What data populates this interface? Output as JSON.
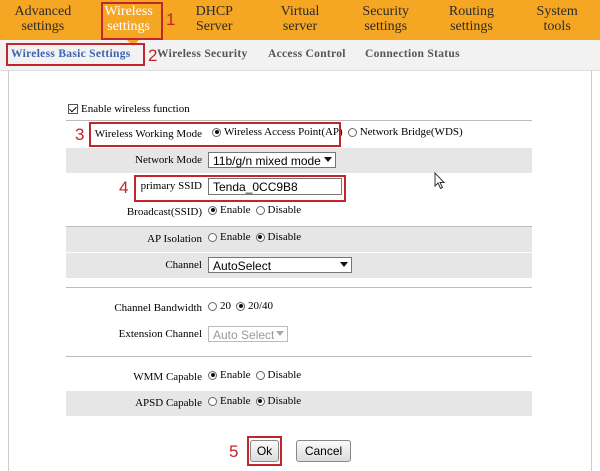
{
  "nav": {
    "items": [
      {
        "line1": "Advanced",
        "line2": "settings"
      },
      {
        "line1": "Wireless",
        "line2": "settings"
      },
      {
        "line1": "DHCP",
        "line2": "Server"
      },
      {
        "line1": "Virtual",
        "line2": "server"
      },
      {
        "line1": "Security",
        "line2": "settings"
      },
      {
        "line1": "Routing",
        "line2": "settings"
      },
      {
        "line1": "System",
        "line2": "tools"
      }
    ]
  },
  "subnav": {
    "items": [
      "Wireless Basic Settings",
      "Wireless Security",
      "Access Control",
      "Connection Status"
    ]
  },
  "annotations": [
    "1",
    "2",
    "3",
    "4",
    "5"
  ],
  "form": {
    "enable_wireless": {
      "label": "Enable wireless function",
      "checked": true
    },
    "working_mode": {
      "label": "Wireless Working Mode",
      "option_ap": "Wireless Access Point(AP)",
      "option_wds": "Network Bridge(WDS)",
      "selected": "ap"
    },
    "network_mode": {
      "label": "Network Mode",
      "value": "11b/g/n mixed mode"
    },
    "ssid": {
      "label": "primary SSID",
      "value": "Tenda_0CC9B8"
    },
    "broadcast": {
      "label": "Broadcast(SSID)",
      "enable": "Enable",
      "disable": "Disable",
      "selected": "enable"
    },
    "ap_isolation": {
      "label": "AP Isolation",
      "enable": "Enable",
      "disable": "Disable",
      "selected": "disable"
    },
    "channel": {
      "label": "Channel",
      "value": "AutoSelect"
    },
    "bandwidth": {
      "label": "Channel Bandwidth",
      "opt20": "20",
      "opt2040": "20/40",
      "selected": "20/40"
    },
    "extension_channel": {
      "label": "Extension Channel",
      "value": "Auto Select"
    },
    "wmm": {
      "label": "WMM Capable",
      "enable": "Enable",
      "disable": "Disable",
      "selected": "enable"
    },
    "apsd": {
      "label": "APSD Capable",
      "enable": "Enable",
      "disable": "Disable",
      "selected": "disable"
    }
  },
  "buttons": {
    "ok": "Ok",
    "cancel": "Cancel"
  },
  "colors": {
    "nav_bg": "#f5a623",
    "highlight": "#c0262c",
    "active_subtab": "#3a63b3",
    "row_shade": "#e6e6e6"
  }
}
